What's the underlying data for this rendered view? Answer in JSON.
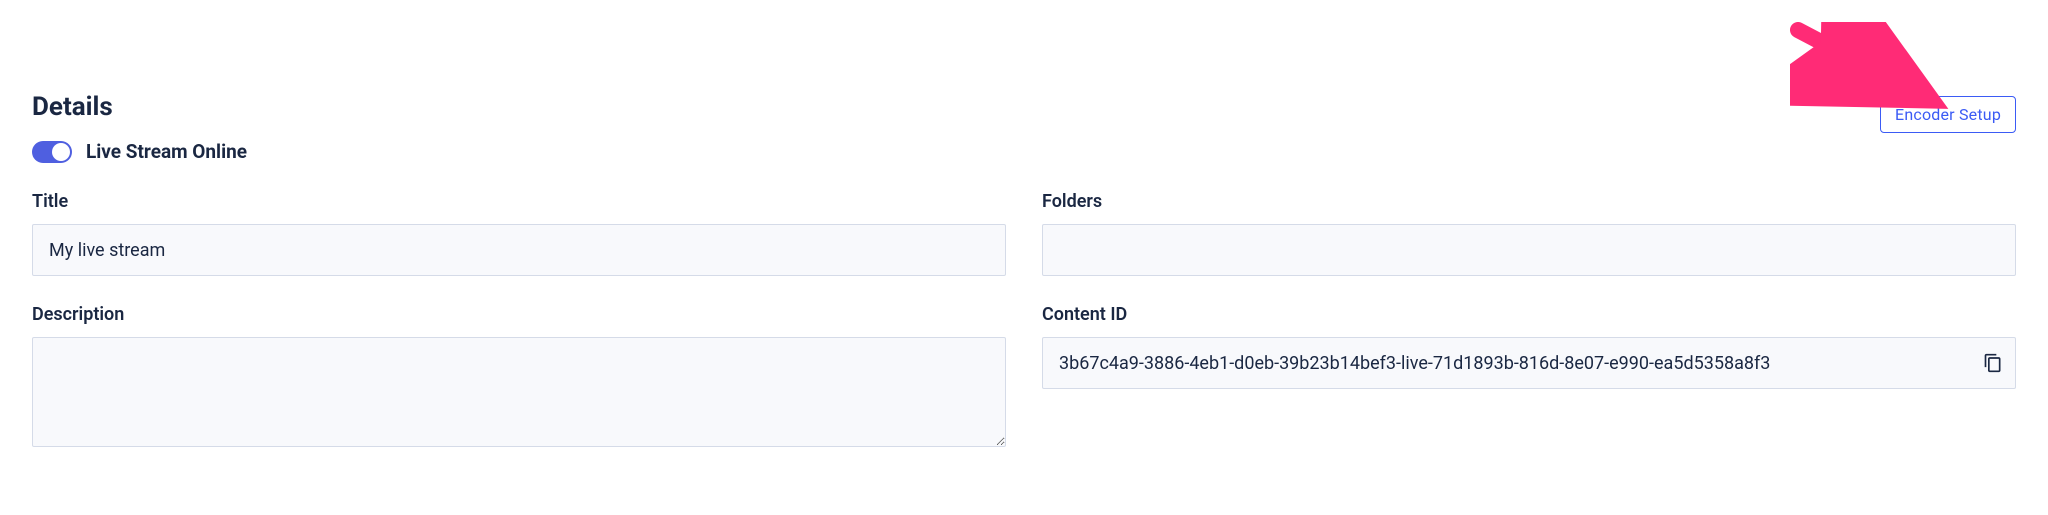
{
  "header": {
    "title": "Details",
    "encoder_button": "Encoder Setup"
  },
  "toggle": {
    "label": "Live Stream Online",
    "on": true
  },
  "fields": {
    "title_label": "Title",
    "title_value": "My live stream",
    "description_label": "Description",
    "description_value": "",
    "folders_label": "Folders",
    "folders_value": "",
    "content_id_label": "Content ID",
    "content_id_value": "3b67c4a9-3886-4eb1-d0eb-39b23b14bef3-live-71d1893b-816d-8e07-e990-ea5d5358a8f3"
  },
  "annotation": {
    "arrow_color": "#ff2b76"
  }
}
